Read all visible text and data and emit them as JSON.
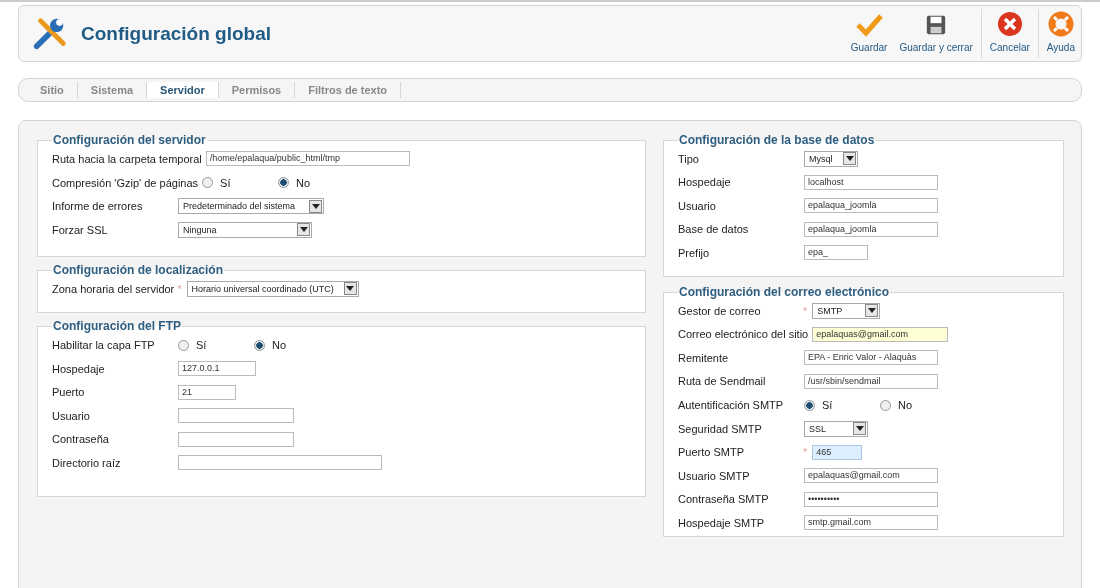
{
  "header": {
    "title": "Configuración global"
  },
  "toolbar": [
    {
      "kind": "save",
      "label": "Guardar"
    },
    {
      "kind": "save-close",
      "label": "Guardar y cerrar"
    },
    {
      "kind": "cancel",
      "label": "Cancelar"
    },
    {
      "kind": "help",
      "label": "Ayuda"
    }
  ],
  "tabs": [
    {
      "label": "Sitio",
      "selected": false
    },
    {
      "label": "Sistema",
      "selected": false
    },
    {
      "label": "Servidor",
      "selected": true
    },
    {
      "label": "Permisos",
      "selected": false
    },
    {
      "label": "Filtros de texto",
      "selected": false
    }
  ],
  "columns": [
    {
      "sections": [
        {
          "title": "Configuración del servidor",
          "fields": [
            {
              "kind": "text",
              "label": "Ruta hacia la carpeta temporal",
              "value": "/home/epalaqua/public_html/tmp"
            },
            {
              "kind": "radio",
              "label": "Compresión 'Gzip' de páginas",
              "options": [
                {
                  "label": "Sí",
                  "selected": false
                },
                {
                  "label": "No",
                  "selected": true
                }
              ]
            },
            {
              "kind": "select",
              "label": "Informe de errores",
              "value": "Predeterminado del sistema"
            },
            {
              "kind": "select",
              "label": "Forzar SSL",
              "value": "Ninguna"
            }
          ]
        },
        {
          "title": "Configuración de localización",
          "fields": [
            {
              "kind": "select",
              "label": "Zona horaria del servidor",
              "required_mark": "*",
              "value": "Horario universal coordinado (UTC)"
            }
          ]
        },
        {
          "title": "Configuración del FTP",
          "fields": [
            {
              "kind": "radio",
              "label": "Habilitar la capa FTP",
              "options": [
                {
                  "label": "Sí",
                  "selected": false
                },
                {
                  "label": "No",
                  "selected": true
                }
              ]
            },
            {
              "kind": "text",
              "label": "Hospedaje",
              "value": "127.0.0.1"
            },
            {
              "kind": "text",
              "label": "Puerto",
              "value": "21"
            },
            {
              "kind": "text",
              "label": "Usuario"
            },
            {
              "kind": "text",
              "label": "Contraseña"
            },
            {
              "kind": "text",
              "label": "Directorio raíz"
            }
          ]
        }
      ]
    },
    {
      "sections": [
        {
          "title": "Configuración de la base de datos",
          "fields": [
            {
              "kind": "select",
              "label": "Tipo",
              "value": "Mysql"
            },
            {
              "kind": "text",
              "label": "Hospedaje",
              "value": "localhost"
            },
            {
              "kind": "text",
              "label": "Usuario",
              "value": "epalaqua_joomla"
            },
            {
              "kind": "text",
              "label": "Base de datos",
              "value": "epalaqua_joomla"
            },
            {
              "kind": "text",
              "label": "Prefijo",
              "value": "epa_"
            }
          ]
        },
        {
          "title": "Configuración del correo electrónico",
          "fields": [
            {
              "kind": "select",
              "label": "Gestor de correo",
              "required_mark": "*",
              "value": "SMTP"
            },
            {
              "kind": "text",
              "label": "Correo electrónico del sitio",
              "value": "epalaquas@gmail.com",
              "autofilled": true
            },
            {
              "kind": "text",
              "label": "Remitente",
              "value": "EPA - Enric Valor - Alaquàs"
            },
            {
              "kind": "text",
              "label": "Ruta de Sendmail",
              "value": "/usr/sbin/sendmail"
            },
            {
              "kind": "radio",
              "label": "Autentificación SMTP",
              "options": [
                {
                  "label": "Sí",
                  "selected": true
                },
                {
                  "label": "No",
                  "selected": false
                }
              ]
            },
            {
              "kind": "select",
              "label": "Seguridad SMTP",
              "value": "SSL"
            },
            {
              "kind": "text",
              "label": "Puerto SMTP",
              "required_mark": "*",
              "value": "465",
              "focused": true
            },
            {
              "kind": "text",
              "label": "Usuario SMTP",
              "value": "epalaquas@gmail.com"
            },
            {
              "kind": "text",
              "label": "Contraseña SMTP",
              "value": "••••••••••"
            },
            {
              "kind": "text",
              "label": "Hospedaje SMTP",
              "value": "smtp.gmail.com"
            }
          ]
        }
      ]
    }
  ]
}
